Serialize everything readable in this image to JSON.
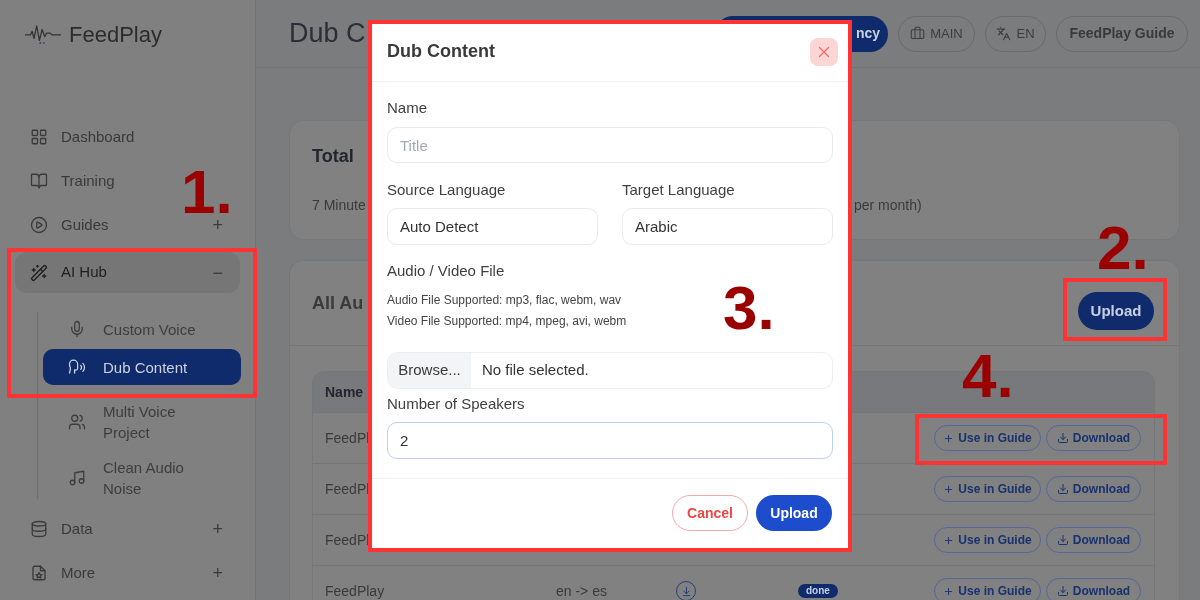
{
  "sidebar": {
    "brand": "FeedPlay",
    "items": [
      {
        "label": "Dashboard",
        "expanded": false
      },
      {
        "label": "Training",
        "expanded": false
      },
      {
        "label": "Guides",
        "toggle": "+",
        "expanded": false
      },
      {
        "label": "AI Hub",
        "toggle": "−",
        "expanded": true,
        "children": [
          {
            "label": "Custom Voice",
            "selected": false
          },
          {
            "label": "Dub Content",
            "selected": true
          },
          {
            "label": "Multi Voice Project",
            "selected": false
          },
          {
            "label": "Clean Audio Noise",
            "selected": false
          }
        ]
      },
      {
        "label": "Data",
        "toggle": "+",
        "expanded": false
      },
      {
        "label": "More",
        "toggle": "+",
        "expanded": false
      }
    ]
  },
  "header": {
    "title": "Dub C",
    "buttons": [
      {
        "kind": "primary",
        "label": "ncy"
      },
      {
        "kind": "workspace",
        "label": "MAIN"
      },
      {
        "kind": "language",
        "label": "EN"
      },
      {
        "kind": "guide",
        "label": "FeedPlay Guide"
      }
    ]
  },
  "usage_card": {
    "title": "Total",
    "line_start": "7 Minute",
    "line_end": "per month)"
  },
  "audio_card": {
    "title": "All Au",
    "upload_button": "Upload",
    "table": {
      "columns": [
        "Name"
      ],
      "rows": [
        {
          "name": "FeedPl",
          "actions": [
            {
              "kind": "add",
              "label": "Use in Guide"
            },
            {
              "kind": "download",
              "label": "Download"
            }
          ]
        },
        {
          "name": "FeedPl",
          "actions": [
            {
              "kind": "add",
              "label": "Use in Guide"
            },
            {
              "kind": "download",
              "label": "Download"
            }
          ]
        },
        {
          "name": "FeedPl",
          "actions": [
            {
              "kind": "add",
              "label": "Use in Guide"
            },
            {
              "kind": "download",
              "label": "Download"
            }
          ]
        },
        {
          "name": "FeedPlay",
          "language": "en -> es",
          "status": "done",
          "actions": [
            {
              "kind": "add",
              "label": "Use in Guide"
            },
            {
              "kind": "download",
              "label": "Download"
            }
          ]
        }
      ]
    }
  },
  "modal": {
    "title": "Dub Content",
    "name_field": {
      "label": "Name",
      "placeholder": "Title"
    },
    "source_language": {
      "label": "Source Language",
      "value": "Auto Detect"
    },
    "target_language": {
      "label": "Target Language",
      "value": "Arabic"
    },
    "file": {
      "label": "Audio / Video File",
      "hints": [
        "Audio File Supported: mp3, flac, webm, wav",
        "Video File Supported: mp4, mpeg, avi, webm"
      ],
      "browse": "Browse...",
      "status": "No file selected."
    },
    "speakers": {
      "label": "Number of Speakers",
      "value": "2"
    },
    "buttons": [
      {
        "kind": "cancel",
        "label": "Cancel"
      },
      {
        "kind": "primary",
        "label": "Upload"
      }
    ]
  },
  "annotations": [
    {
      "label": "1."
    },
    {
      "label": "2."
    },
    {
      "label": "3."
    },
    {
      "label": "4."
    }
  ]
}
